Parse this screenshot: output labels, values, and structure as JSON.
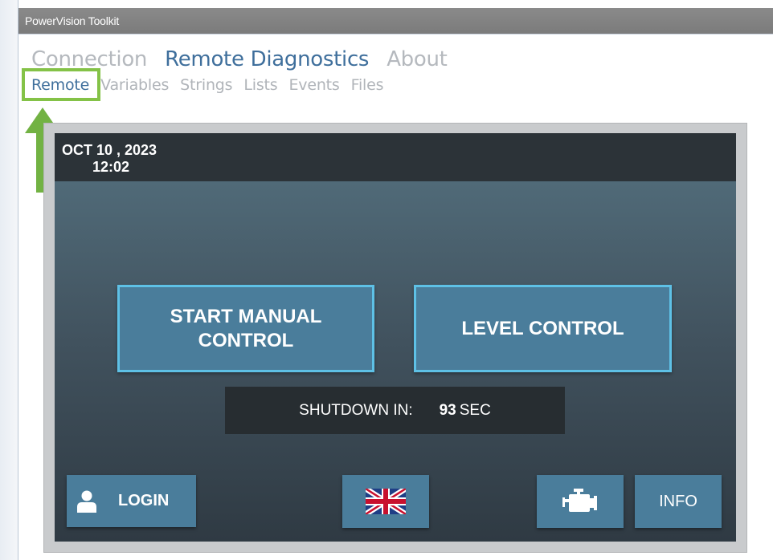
{
  "window": {
    "title": "PowerVision Toolkit"
  },
  "main_nav": [
    {
      "label": "Connection",
      "active": false
    },
    {
      "label": "Remote Diagnostics",
      "active": true
    },
    {
      "label": "About",
      "active": false
    }
  ],
  "sub_nav": [
    {
      "label": "Remote",
      "active": true
    },
    {
      "label": "Variables",
      "active": false
    },
    {
      "label": "Strings",
      "active": false
    },
    {
      "label": "Lists",
      "active": false
    },
    {
      "label": "Events",
      "active": false
    },
    {
      "label": "Files",
      "active": false
    }
  ],
  "hmi": {
    "date": "OCT 10 , 2023",
    "time": "12:02",
    "start_manual_line1": "START MANUAL",
    "start_manual_line2": "CONTROL",
    "level_control": "LEVEL CONTROL",
    "shutdown_label": "SHUTDOWN IN:",
    "shutdown_value": "93",
    "shutdown_unit": "SEC",
    "login_label": "LOGIN",
    "info_label": "INFO",
    "icons": {
      "login": "user-icon",
      "flag": "uk-flag-icon",
      "engine": "engine-icon"
    }
  },
  "colors": {
    "accent": "#3f6f9c",
    "highlight": "#84c247",
    "button": "#4a7d9b",
    "button_border": "#5ec1e6"
  }
}
